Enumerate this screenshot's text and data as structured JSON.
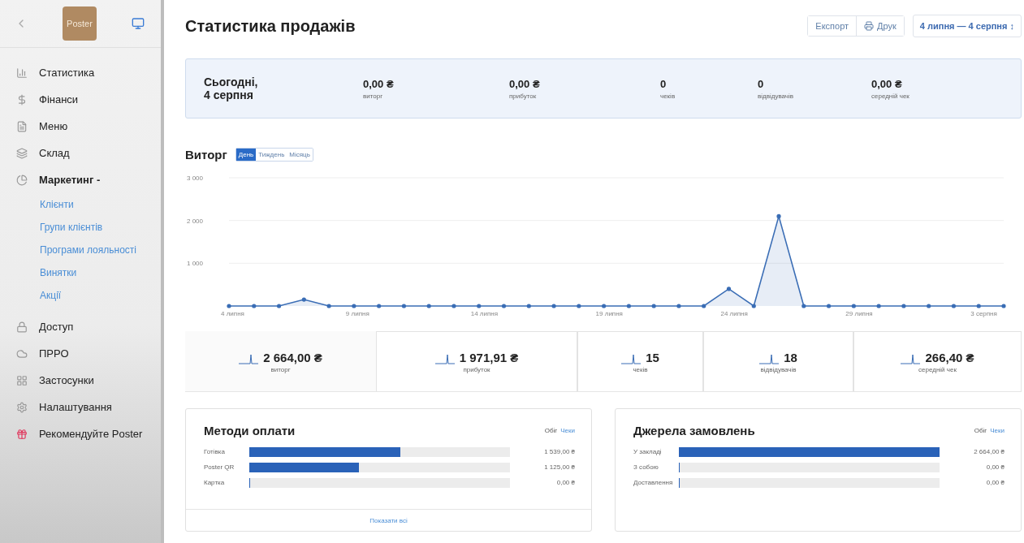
{
  "sidebar": {
    "logo": "Poster",
    "items": [
      {
        "label": "Статистика",
        "expanded": false
      },
      {
        "label": "Фінанси",
        "expanded": false
      },
      {
        "label": "Меню",
        "expanded": false
      },
      {
        "label": "Склад",
        "expanded": false
      },
      {
        "label": "Маркетинг -",
        "expanded": true,
        "children": [
          "Клієнти",
          "Групи клієнтів",
          "Програми лояльності",
          "Винятки",
          "Акції"
        ]
      },
      {
        "label": "Доступ",
        "expanded": false
      },
      {
        "label": "ПРРО",
        "expanded": false
      },
      {
        "label": "Застосунки",
        "expanded": false
      },
      {
        "label": "Налаштування",
        "expanded": false
      },
      {
        "label": "Рекомендуйте Poster",
        "expanded": false
      }
    ]
  },
  "header": {
    "title": "Статистика продажів",
    "buttons": [
      "Експорт",
      "Друк"
    ],
    "date_range": "4 липня — 4 серпня ↕"
  },
  "today": {
    "title": "Сьогодні,\n4 серпня",
    "stats": [
      {
        "value": "0,00 ₴",
        "label": "виторг"
      },
      {
        "value": "0,00 ₴",
        "label": "прибуток"
      },
      {
        "value": "0",
        "label": "чеків"
      },
      {
        "value": "0",
        "label": "відвідувачів"
      },
      {
        "value": "0,00 ₴",
        "label": "середній чек"
      }
    ]
  },
  "revenue": {
    "title": "Виторг",
    "periods": [
      {
        "label": "День",
        "selected": true
      },
      {
        "label": "Тиждень",
        "selected": false
      },
      {
        "label": "Місяць",
        "selected": false
      }
    ],
    "chart_data": {
      "type": "area",
      "categories": [
        "4 липня",
        null,
        null,
        null,
        null,
        "9 липня",
        null,
        null,
        null,
        null,
        "14 липня",
        null,
        null,
        null,
        null,
        "19 липня",
        null,
        null,
        null,
        null,
        "24 липня",
        null,
        null,
        null,
        null,
        "29 липня",
        null,
        null,
        null,
        null,
        "3 серпня",
        null
      ],
      "series": [
        {
          "color": "#3a6db5",
          "values": [
            0,
            0,
            0,
            150,
            0,
            0,
            0,
            0,
            0,
            0,
            0,
            0,
            0,
            0,
            0,
            0,
            0,
            0,
            0,
            0,
            400,
            0,
            2100,
            0,
            0,
            0,
            0,
            0,
            0,
            0,
            0,
            0
          ]
        }
      ],
      "ylim": [
        0,
        3000
      ],
      "yticks": [
        {
          "value": 1000,
          "label": "1 000"
        },
        {
          "value": 2000,
          "label": "2 000"
        },
        {
          "value": 3000,
          "label": "3 000"
        }
      ]
    }
  },
  "totals": [
    {
      "value": "2 664,00 ₴",
      "label": "виторг",
      "selected": true
    },
    {
      "value": "1 971,91 ₴",
      "label": "прибуток",
      "selected": false
    },
    {
      "value": "15",
      "label": "чеків",
      "selected": false
    },
    {
      "value": "18",
      "label": "відвідувачів",
      "selected": false
    },
    {
      "value": "266,40 ₴",
      "label": "середній чек",
      "selected": false
    }
  ],
  "panels": [
    {
      "title": "Методи оплати",
      "toggle": [
        "Обіг",
        "Чеки"
      ],
      "rows": [
        {
          "label": "Готівка",
          "level": 0.58,
          "amount": "1 539,00 ₴"
        },
        {
          "label": "Poster QR",
          "level": 0.42,
          "amount": "1 125,00 ₴"
        },
        {
          "label": "Картка",
          "level": 0,
          "amount": "0,00 ₴"
        }
      ],
      "footer": "Показати всі"
    },
    {
      "title": "Джерела замовлень",
      "toggle": [
        "Обіг",
        "Чеки"
      ],
      "rows": [
        {
          "label": "У закладі",
          "level": 1,
          "amount": "2 664,00 ₴"
        },
        {
          "label": "З собою",
          "level": 0,
          "amount": "0,00 ₴"
        },
        {
          "label": "Доставлення",
          "level": 0,
          "amount": "0,00 ₴"
        }
      ]
    }
  ]
}
